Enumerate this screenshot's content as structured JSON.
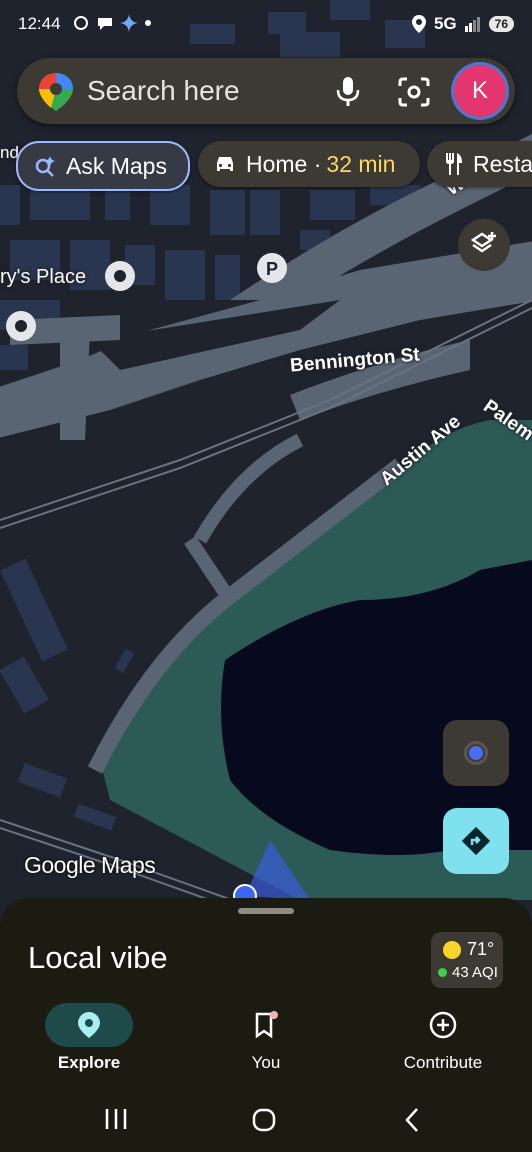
{
  "status": {
    "time": "12:44",
    "network": "5G",
    "battery": "76"
  },
  "search": {
    "placeholder": "Search here",
    "avatar_letter": "K"
  },
  "chips": {
    "ask_label": "Ask Maps",
    "home_label": "Home · ",
    "home_time": "32 min",
    "restaurants_label": "Resta"
  },
  "map": {
    "labels": {
      "bennington": "Bennington St",
      "austin": "Austin Ave",
      "palermo": "Palem",
      "place": "ry's Place",
      "edge_left": "nda",
      "edge_right": "W"
    },
    "attribution": "Google Maps"
  },
  "sheet": {
    "title": "Local vibe",
    "weather_temp": "71°",
    "weather_aqi": "43 AQI"
  },
  "nav": {
    "explore": "Explore",
    "you": "You",
    "contribute": "Contribute"
  },
  "colors": {
    "accent_blue": "#4a78d8",
    "water": "#07091c",
    "park": "#2c5a57",
    "direction_button": "#7fe0ee"
  }
}
